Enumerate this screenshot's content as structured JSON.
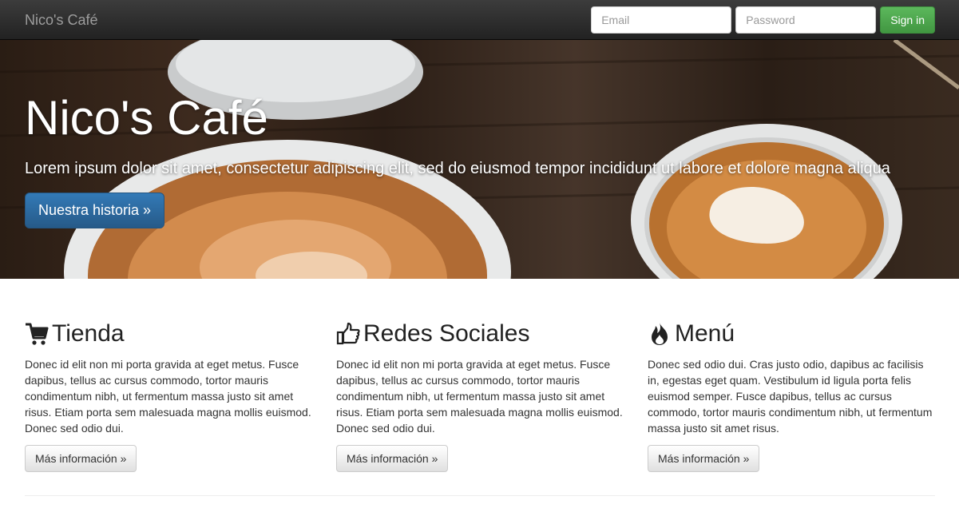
{
  "navbar": {
    "brand": "Nico's Café",
    "email_placeholder": "Email",
    "password_placeholder": "Password",
    "signin_label": "Sign in"
  },
  "hero": {
    "title": "Nico's Café",
    "lead": "Lorem ipsum dolor sit amet, consectetur adipiscing elit, sed do eiusmod tempor incididunt ut labore et dolore magna aliqua",
    "button_label": "Nuestra historia »"
  },
  "columns": [
    {
      "icon": "shopping-cart-icon",
      "title": "Tienda",
      "text": "Donec id elit non mi porta gravida at eget metus. Fusce dapibus, tellus ac cursus commodo, tortor mauris condimentum nibh, ut fermentum massa justo sit amet risus. Etiam porta sem malesuada magna mollis euismod. Donec sed odio dui.",
      "button_label": "Más información »"
    },
    {
      "icon": "thumbs-up-icon",
      "title": "Redes Sociales",
      "text": "Donec id elit non mi porta gravida at eget metus. Fusce dapibus, tellus ac cursus commodo, tortor mauris condimentum nibh, ut fermentum massa justo sit amet risus. Etiam porta sem malesuada magna mollis euismod. Donec sed odio dui.",
      "button_label": "Más información »"
    },
    {
      "icon": "fire-icon",
      "title": "Menú",
      "text": "Donec sed odio dui. Cras justo odio, dapibus ac facilisis in, egestas eget quam. Vestibulum id ligula porta felis euismod semper. Fusce dapibus, tellus ac cursus commodo, tortor mauris condimentum nibh, ut fermentum massa justo sit amet risus.",
      "button_label": "Más información »"
    }
  ],
  "colors": {
    "navbar": "#222222",
    "primary": "#337ab7",
    "success": "#5cb85c"
  }
}
